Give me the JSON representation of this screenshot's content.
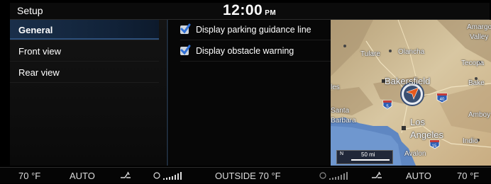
{
  "header": {
    "title": "Setup",
    "time": "12:00",
    "ampm": "PM"
  },
  "menu": {
    "items": [
      {
        "label": "General",
        "active": true
      },
      {
        "label": "Front view",
        "active": false
      },
      {
        "label": "Rear view",
        "active": false
      }
    ]
  },
  "options": [
    {
      "label": "Display parking guidance line",
      "checked": true
    },
    {
      "label": "Display obstacle warning",
      "checked": true
    }
  ],
  "map": {
    "labels": {
      "amargosa": "Amargos",
      "valley": "Valley",
      "tulare": "Tulare",
      "olancha": "Olancha",
      "tecopa": "Tecopa",
      "bakersfield": "Bakersfield",
      "bake": "Bake",
      "les": "les",
      "santa": "Santa",
      "barbara": "Barbara",
      "amboy": "Amboy",
      "los": "Los",
      "angeles": "Angeles",
      "indio": "Indio",
      "avalon": "Avalon"
    },
    "shields": {
      "i5": "5",
      "i40": "40",
      "i15": "15"
    },
    "scale": {
      "north": "N",
      "distance": "50 mi"
    }
  },
  "climate": {
    "left_temp": "70 °F",
    "left_mode": "AUTO",
    "outside": "OUTSIDE  70 °F",
    "right_mode": "AUTO",
    "right_temp": "70 °F"
  },
  "icons": {
    "left_airflow": "airflow-icon",
    "left_fan": "fan-speed-icon",
    "right_fan": "fan-speed-icon",
    "right_airflow": "airflow-icon"
  },
  "colors": {
    "active_menu": "#1a2f4a",
    "checkbox": "#2f6fd6",
    "map_land": "#cdbb98",
    "map_water": "#5f87c2"
  }
}
